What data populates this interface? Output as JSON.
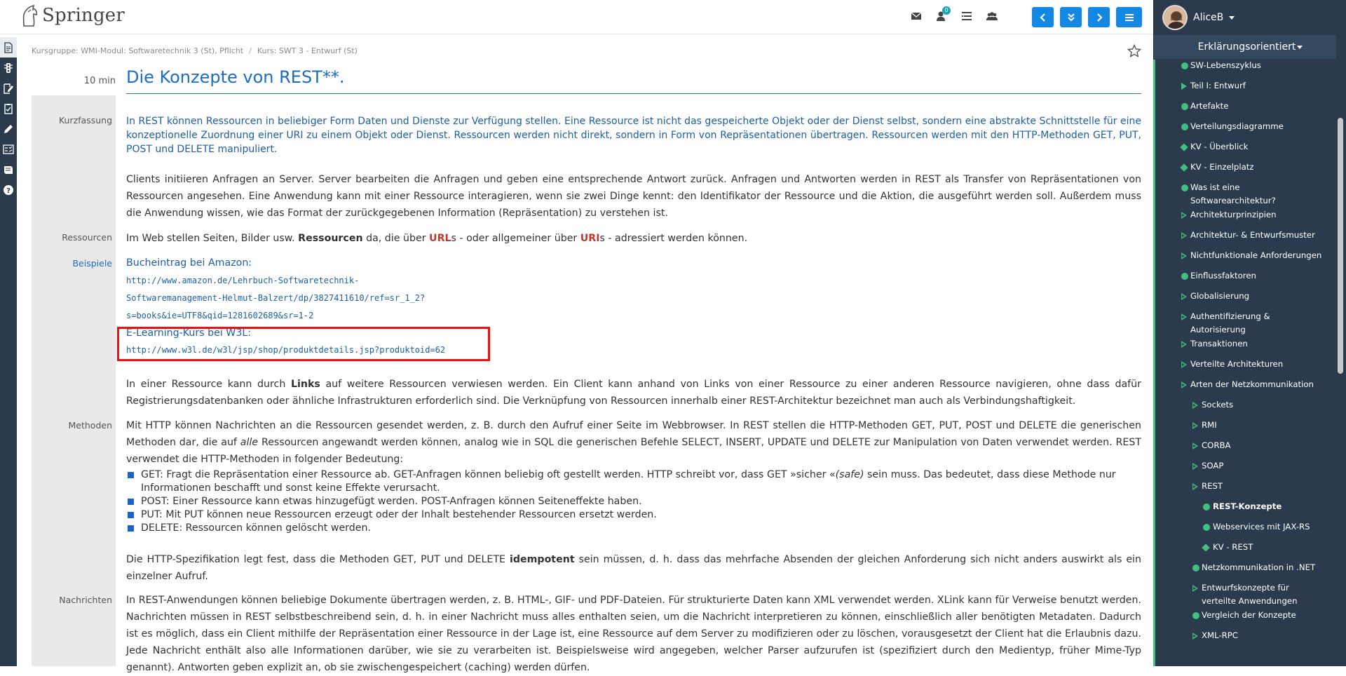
{
  "app": {
    "logo_text": "Springer",
    "colors": {
      "primary": "#1388e3",
      "link": "#1c6cc4",
      "sidebar": "#2b3b4d",
      "accent_green": "#3fc07e",
      "highlight_box": "#e11111"
    }
  },
  "topbar": {
    "icons": [
      "envelope-icon",
      "bell-icon",
      "list-icon",
      "users-icon"
    ],
    "notification_count": "0",
    "nav_buttons": [
      "chevron-left-icon",
      "double-chevron-down-icon",
      "chevron-right-icon",
      "hamburger-icon"
    ]
  },
  "left_rail": {
    "icons": [
      "document-icon",
      "traffic-light-icon",
      "edit-document-icon",
      "checklist-icon",
      "pencil-icon",
      "quiz-icon",
      "book-icon",
      "help-icon"
    ]
  },
  "breadcrumb": {
    "items": [
      "Kursgruppe: WMI-Modul: Softwaretechnik 3 (St), Pflicht",
      "Kurs: SWT 3 - Entwurf (St)"
    ]
  },
  "lesson": {
    "duration": "10 min",
    "title": "Die Konzepte von REST**."
  },
  "labels": {
    "kurzfassung": "Kurzfassung",
    "ressourcen": "Ressourcen",
    "beispiele": "Beispiele",
    "methoden": "Methoden",
    "nachrichten": "Nachrichten"
  },
  "content": {
    "kurzfassung": "In REST können Ressourcen in beliebiger Form Daten und Dienste zur Verfügung stellen. Eine Ressource ist nicht das gespeicherte Objekt oder der Dienst selbst, sondern eine abstrakte Schnittstelle für eine konzeptionelle Zuordnung einer URI zu einem Objekt oder Dienst. Ressourcen werden nicht direkt, sondern in Form von Repräsentationen übertragen. Ressourcen werden mit den HTTP-Methoden GET, PUT, POST und DELETE manipuliert.",
    "clients": "Clients initiieren Anfragen an Server. Server bearbeiten die Anfragen und geben eine entsprechende Antwort zurück. Anfragen und Antworten werden in REST als Transfer von Repräsentationen von Ressourcen angesehen. Eine Anwendung kann mit einer Ressource interagieren, wenn sie zwei Dinge kennt: den Identifikator der Ressource und die Aktion, die ausgeführt werden soll. Außerdem muss die Anwendung wissen, wie das Format der zurückgegebenen Information (Repräsentation) zu verstehen ist.",
    "ressourcen_pre": "Im Web stellen Seiten, Bilder usw. ",
    "ressourcen_bold": "Ressourcen",
    "ressourcen_mid1": " da, die über ",
    "ressourcen_url": "URL",
    "ressourcen_mid2": "s - oder allgemeiner über ",
    "ressourcen_uri": "URI",
    "ressourcen_post": "s - adressiert werden können.",
    "example1_title": "Bucheintrag bei Amazon:",
    "example1_url_line1": "http://www.amazon.de/Lehrbuch-Softwaretechnik-",
    "example1_url_line2": "Softwaremanagement-Helmut-Balzert/dp/3827411610/ref=sr_1_2?",
    "example1_url_line3": "s=books&ie=UTF8&qid=1281602689&sr=1-2",
    "example2_title": "E-Learning-Kurs bei W3L:",
    "example2_url": "http://www.w3l.de/w3l/jsp/shop/produktdetails.jsp?produktoid=62",
    "links_pre": "In einer Ressource kann durch ",
    "links_bold": "Links",
    "links_post": " auf weitere Ressourcen verwiesen werden. Ein Client kann anhand von Links von einer Ressource zu einer anderen Ressource navigieren, ohne dass dafür Registrierungsdatenbanken oder ähnliche Infrastrukturen erforderlich sind. Die Verknüpfung von Ressourcen innerhalb einer REST-Architektur bezeichnet man auch als Verbindungshaftigkeit.",
    "methoden_pre": "Mit HTTP können Nachrichten an die Ressourcen gesendet werden, z. B. durch den Aufruf einer Seite im Webbrowser. In REST stellen die HTTP-Methoden GET, PUT, POST und DELETE die generischen Methoden dar, die auf ",
    "methoden_italic": "alle",
    "methoden_post": " Ressourcen angewandt werden können, analog wie in SQL die generischen Befehle SELECT, INSERT, UPDATE und DELETE zur Manipulation von Daten verwendet werden. REST verwendet die HTTP-Methoden in folgender Bedeutung:",
    "method_get_pre": "GET: Fragt die Repräsentation einer Ressource ab. GET-Anfragen können beliebig oft gestellt werden. HTTP schreibt vor, dass GET »sicher «",
    "method_get_italic": "(safe)",
    "method_get_post": " sein muss. Das bedeutet, dass diese Methode nur Informationen beschafft und sonst keine Effekte verursacht.",
    "method_post": "POST: Einer Ressource kann etwas hinzugefügt werden. POST-Anfragen können Seiteneffekte haben.",
    "method_put": "PUT: Mit PUT können neue Ressourcen erzeugt oder der Inhalt bestehender Ressourcen ersetzt werden.",
    "method_delete": "DELETE: Ressourcen können gelöscht werden.",
    "idempotent_pre": "Die HTTP-Spezifikation legt fest, dass die Methoden GET, PUT und DELETE ",
    "idempotent_bold": "idempotent",
    "idempotent_post": " sein müssen, d. h. dass das mehrfache Absenden der gleichen Anforderung sich nicht anders auswirkt als ein einzelner Aufruf.",
    "nachrichten": "In REST-Anwendungen können beliebige Dokumente übertragen werden, z. B. HTML-, GIF- und PDF-Dateien. Für strukturierte Daten kann XML verwendet werden. XLink kann für Verweise benutzt werden. Nachrichten müssen in REST selbstbeschreibend sein, d. h. in einer Nachricht muss alles enthalten seien, um die Nachricht interpretieren zu können, einschließlich aller benötigten Metadaten. Dadurch ist es möglich, dass ein Client mithilfe der Repräsentation einer Ressource in der Lage ist, eine Ressource auf dem Server zu modifizieren oder zu löschen, vorausgesetzt der Client hat die Erlaubnis dazu. Jede Nachricht enthält also alle Informationen darüber, wie sie zu verarbeiten ist. Beispielsweise wird angegeben, welcher Parser aufzurufen ist (spezifiziert durch den Medientyp, früher Mime-Typ genannt). Antworten geben explizit an, ob sie zwischengespeichert (caching) werden dürfen."
  },
  "sidebar": {
    "username": "AliceB",
    "mode": "Erklärungsorientiert",
    "tree": [
      {
        "label": "SW-Lebenszyklus",
        "marker": "circle",
        "indent": 0
      },
      {
        "label": "Teil I: Entwurf",
        "marker": "triangle",
        "indent": 0
      },
      {
        "label": "Artefakte",
        "marker": "circle",
        "indent": 0
      },
      {
        "label": "Verteilungsdiagramme",
        "marker": "circle",
        "indent": 0
      },
      {
        "label": "KV - Überblick",
        "marker": "diamond",
        "indent": 0
      },
      {
        "label": "KV - Einzelplatz",
        "marker": "diamond",
        "indent": 0
      },
      {
        "label": "Was ist eine",
        "label2": "Softwarearchitektur?",
        "marker": "circle",
        "indent": 0
      },
      {
        "label": "Architekturprinzipien",
        "marker": "triangle-open",
        "indent": 0
      },
      {
        "label": "Architektur- & Entwurfsmuster",
        "marker": "triangle-open",
        "indent": 0
      },
      {
        "label": "Nichtfunktionale Anforderungen",
        "marker": "triangle-open",
        "indent": 0
      },
      {
        "label": "Einflussfaktoren",
        "marker": "circle",
        "indent": 0
      },
      {
        "label": "Globalisierung",
        "marker": "triangle-open",
        "indent": 0
      },
      {
        "label": "Authentifizierung &",
        "label2": "Autorisierung",
        "marker": "triangle-open",
        "indent": 0
      },
      {
        "label": "Transaktionen",
        "marker": "triangle-open",
        "indent": 0
      },
      {
        "label": "Verteilte Architekturen",
        "marker": "triangle-open",
        "indent": 0
      },
      {
        "label": "Arten der Netzkommunikation",
        "marker": "triangle-open",
        "indent": 0
      },
      {
        "label": "Sockets",
        "marker": "triangle-open",
        "indent": 1
      },
      {
        "label": "RMI",
        "marker": "triangle-open",
        "indent": 1
      },
      {
        "label": "CORBA",
        "marker": "triangle-open",
        "indent": 1
      },
      {
        "label": "SOAP",
        "marker": "triangle-open",
        "indent": 1
      },
      {
        "label": "REST",
        "marker": "triangle-open",
        "indent": 1
      },
      {
        "label": "REST-Konzepte",
        "marker": "circle",
        "indent": 2,
        "active": true
      },
      {
        "label": "Webservices mit JAX-RS",
        "marker": "circle",
        "indent": 2
      },
      {
        "label": "KV - REST",
        "marker": "diamond",
        "indent": 2
      },
      {
        "label": "Netzkommunikation in .NET",
        "marker": "circle",
        "indent": 1
      },
      {
        "label": "Entwurfskonzepte für",
        "label2": "verteilte Anwendungen",
        "marker": "triangle-open",
        "indent": 1
      },
      {
        "label": "Vergleich der Konzepte",
        "marker": "circle",
        "indent": 1
      },
      {
        "label": "XML-RPC",
        "marker": "triangle-open",
        "indent": 1
      }
    ]
  }
}
